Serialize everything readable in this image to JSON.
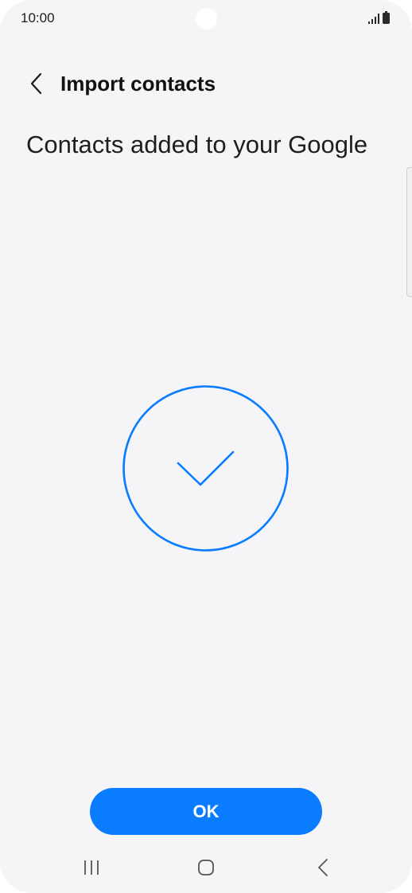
{
  "status_bar": {
    "time": "10:00",
    "icons": [
      "signal-icon",
      "battery-icon"
    ]
  },
  "header": {
    "back_icon": "chevron-left-icon",
    "title": "Import contacts"
  },
  "main": {
    "message": "Contacts added to your Google",
    "success_icon": "checkmark-circle-icon"
  },
  "actions": {
    "ok_label": "OK"
  },
  "nav_bar": {
    "items": [
      "recents-icon",
      "home-icon",
      "back-icon"
    ]
  },
  "colors": {
    "accent": "#0a7cff",
    "background": "#f5f5f7",
    "text": "#1e1e1e"
  }
}
